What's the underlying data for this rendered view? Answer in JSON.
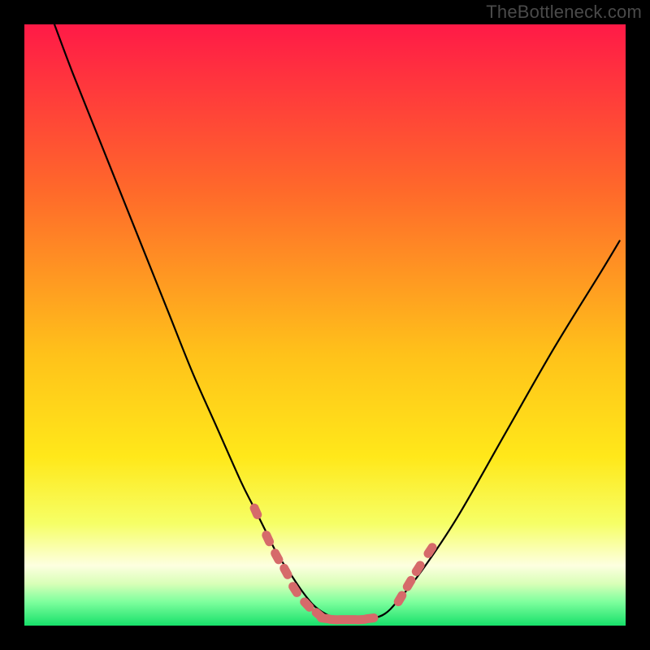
{
  "watermark": "TheBottleneck.com",
  "chart_data": {
    "type": "line",
    "title": "",
    "xlabel": "",
    "ylabel": "",
    "xlim": [
      0,
      100
    ],
    "ylim": [
      0,
      100
    ],
    "gradient_colors": {
      "top": "#ff1a47",
      "upper_mid": "#ff8a1f",
      "mid": "#ffe31a",
      "lower_mid": "#f6ff66",
      "ivory": "#fdffe0",
      "green_light": "#7fff9e",
      "green": "#17e06a"
    },
    "series": [
      {
        "name": "curve",
        "type": "line",
        "color": "#000000",
        "x": [
          5,
          8,
          12,
          16,
          20,
          24,
          28,
          32,
          36,
          38,
          40,
          42,
          44,
          46,
          48,
          50,
          52,
          54,
          56,
          58,
          60,
          62,
          66,
          72,
          80,
          88,
          96,
          99
        ],
        "y": [
          100,
          92,
          82,
          72,
          62,
          52,
          42,
          33,
          24,
          20,
          16,
          12,
          9,
          6,
          3.5,
          2,
          1.2,
          1,
          1,
          1.2,
          2,
          4,
          9,
          18,
          32,
          46,
          59,
          64
        ]
      },
      {
        "name": "left-markers",
        "type": "scatter",
        "color": "#d66a6a",
        "x": [
          38.5,
          40.5,
          42,
          43.5,
          45,
          47,
          49
        ],
        "y": [
          19,
          14.5,
          11.5,
          9,
          6,
          3.5,
          1.8
        ]
      },
      {
        "name": "bottom-markers",
        "type": "scatter",
        "color": "#d66a6a",
        "x": [
          50,
          51.5,
          53,
          54.5,
          56,
          57.5
        ],
        "y": [
          1.2,
          1,
          1,
          1,
          1,
          1.2
        ]
      },
      {
        "name": "right-markers",
        "type": "scatter",
        "color": "#d66a6a",
        "x": [
          62.5,
          64,
          65.5,
          67.5
        ],
        "y": [
          4.5,
          7,
          9.5,
          12.5
        ]
      }
    ]
  }
}
